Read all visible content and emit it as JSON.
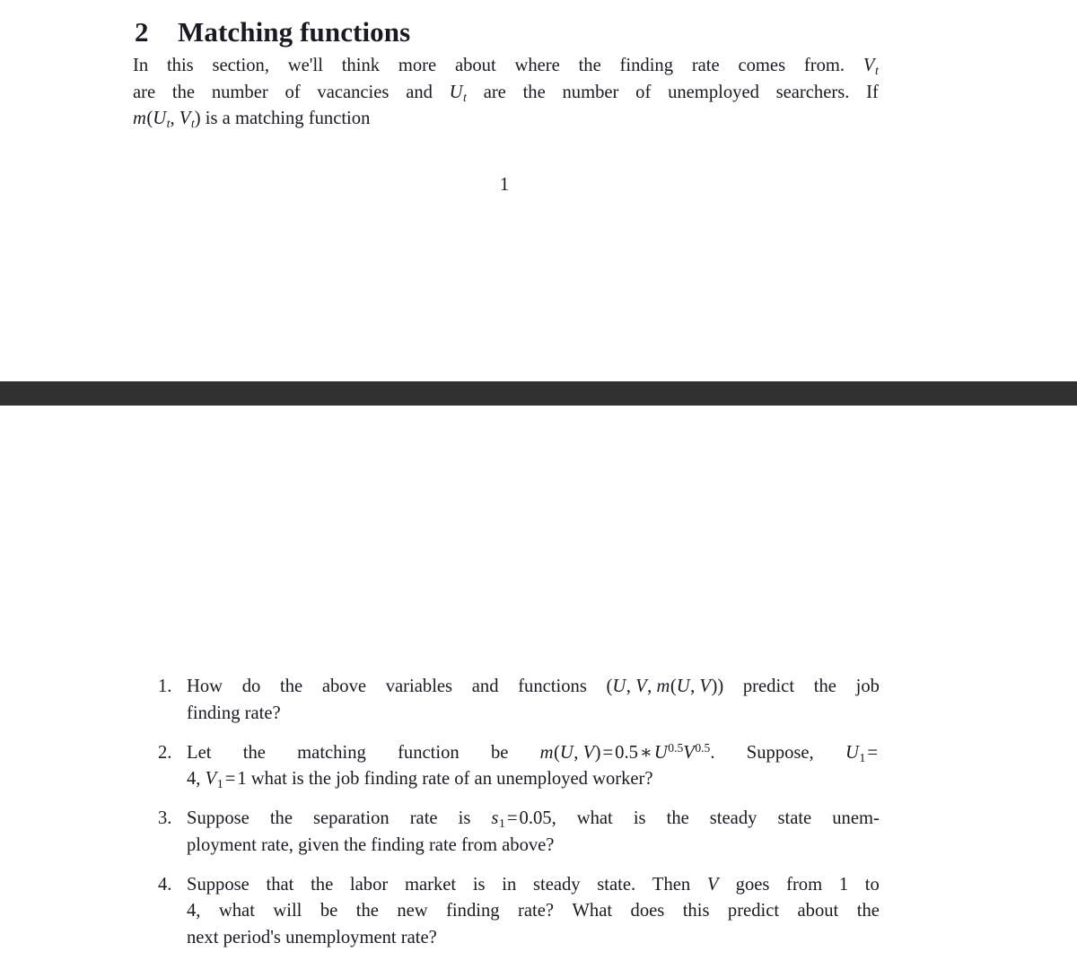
{
  "document": {
    "section": {
      "number": "2",
      "title": "Matching functions"
    },
    "intro_paragraph": {
      "line1_a": "In",
      "line1_b": "this",
      "line1_c": "section,",
      "line1_d": "we'll",
      "line1_e": "think",
      "line1_f": "more",
      "line1_g": "about",
      "line1_h": "where",
      "line1_i": "the",
      "line1_j": "finding",
      "line1_k": "rate",
      "line1_l": "comes",
      "line1_m": "from.",
      "line1_math_V": "V",
      "line1_math_V_sub": "t",
      "line2_a": "are",
      "line2_b": "the",
      "line2_c": "number",
      "line2_d": "of",
      "line2_e": "vacancies",
      "line2_f": "and",
      "line2_math_U": "U",
      "line2_math_U_sub": "t",
      "line2_g": "are",
      "line2_h": "the",
      "line2_i": "number",
      "line2_j": "of",
      "line2_k": "unemployed",
      "line2_l": "searchers.",
      "line2_m": "If",
      "line3_math_m": "m",
      "line3_math_paren_open": "(",
      "line3_math_U": "U",
      "line3_math_U_sub": "t",
      "line3_math_comma": ", ",
      "line3_math_V": "V",
      "line3_math_V_sub": "t",
      "line3_math_paren_close": ")",
      "line3_rest": " is a matching function",
      "plain_text": "In this section, we'll think more about where the finding rate comes from. V_t are the number of vacancies and U_t are the number of unemployed searchers. If m(U_t, V_t) is a matching function"
    },
    "page_number": "1",
    "separator_color": "#313131",
    "questions": [
      {
        "number": "1.",
        "line1_a": "How",
        "line1_b": "do",
        "line1_c": "the",
        "line1_d": "above",
        "line1_e": "variables",
        "line1_f": "and",
        "line1_g": "functions",
        "line1_math_open": "(",
        "line1_math_U": "U",
        "line1_math_c1": ", ",
        "line1_math_V": "V",
        "line1_math_c2": ", ",
        "line1_math_m": "m",
        "line1_math_open2": "(",
        "line1_math_U2": "U",
        "line1_math_c3": ", ",
        "line1_math_V2": "V",
        "line1_math_close2": ")",
        "line1_math_close": ")",
        "line1_h": "predict",
        "line1_i": "the",
        "line1_j": "job",
        "line2": "finding rate?",
        "plain_text": "How do the above variables and functions (U, V, m(U, V)) predict the job finding rate?"
      },
      {
        "number": "2.",
        "line1_a": "Let",
        "line1_b": "the",
        "line1_c": "matching",
        "line1_d": "function",
        "line1_e": "be",
        "line1_math_m": "m",
        "line1_math_open": "(",
        "line1_math_U": "U",
        "line1_math_c1": ", ",
        "line1_math_V": "V",
        "line1_math_close": ")",
        "line1_math_eq": "=",
        "line1_math_coef": "0.5",
        "line1_math_times": "∗",
        "line1_math_Ubase": "U",
        "line1_math_Uexp": "0.5",
        "line1_math_Vbase": "V",
        "line1_math_Vexp": "0.5",
        "line1_period": ".",
        "line1_f": "Suppose,",
        "line1_math_U1": "U",
        "line1_math_U1_sub": "1",
        "line1_math_eq2": "=",
        "line2_math_4": "4,",
        "line2_math_V1": "V",
        "line2_math_V1_sub": "1",
        "line2_math_eq": "=",
        "line2_math_1": "1",
        "line2_rest": " what is the job finding rate of an unemployed worker?",
        "plain_text": "Let the matching function be m(U, V) = 0.5 * U^0.5 V^0.5. Suppose, U_1 = 4, V_1 = 1 what is the job finding rate of an unemployed worker?"
      },
      {
        "number": "3.",
        "line1_a": "Suppose",
        "line1_b": "the",
        "line1_c": "separation",
        "line1_d": "rate",
        "line1_e": "is",
        "line1_math_s": "s",
        "line1_math_s_sub": "1",
        "line1_math_eq": "=",
        "line1_math_val": "0.05,",
        "line1_f": "what",
        "line1_g": "is",
        "line1_h": "the",
        "line1_i": "steady",
        "line1_j": "state",
        "line1_k": "unem-",
        "line2": "ployment rate, given the finding rate from above?",
        "plain_text": "Suppose the separation rate is s_1 = 0.05, what is the steady state unemployment rate, given the finding rate from above?"
      },
      {
        "number": "4.",
        "line1_a": "Suppose",
        "line1_b": "that",
        "line1_c": "the",
        "line1_d": "labor",
        "line1_e": "market",
        "line1_f": "is",
        "line1_g": "in",
        "line1_h": "steady",
        "line1_i": "state.",
        "line1_j": "Then",
        "line1_math_V": "V",
        "line1_k": "goes",
        "line1_l": "from",
        "line1_m": "1",
        "line1_n": "to",
        "line2_a": "4,",
        "line2_b": "what",
        "line2_c": "will",
        "line2_d": "be",
        "line2_e": "the",
        "line2_f": "new",
        "line2_g": "finding",
        "line2_h": "rate?",
        "line2_i": "What",
        "line2_j": "does",
        "line2_k": "this",
        "line2_l": "predict",
        "line2_m": "about",
        "line2_n": "the",
        "line3": "next period's unemployment rate?",
        "plain_text": "Suppose that the labor market is in steady state. Then V goes from 1 to 4, what will be the new finding rate? What does this predict about the next period's unemployment rate?"
      }
    ]
  }
}
